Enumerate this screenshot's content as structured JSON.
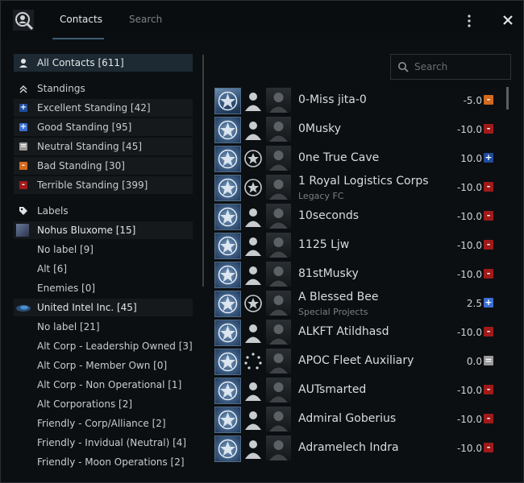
{
  "tabs": {
    "contacts": "Contacts",
    "search": "Search"
  },
  "colors": {
    "excellent": "#1e4c9c",
    "good": "#3a6fd0",
    "neutral": "#9a9a9a",
    "bad": "#d26a1e",
    "terrible": "#a11a1a"
  },
  "left": {
    "all_contacts": "All Contacts [611]",
    "standings_header": "Standings",
    "standings": [
      "Excellent Standing [42]",
      "Good Standing [95]",
      "Neutral Standing [45]",
      "Bad Standing [30]",
      "Terrible Standing [399]"
    ],
    "labels_header": "Labels",
    "group1": {
      "name": "Nohus Bluxome [15]",
      "items": [
        "No label [9]",
        "Alt [6]",
        "Enemies [0]"
      ]
    },
    "group2": {
      "name": "United Intel Inc. [45]",
      "items": [
        "No label [21]",
        "Alt Corp - Leadership Owned [3]",
        "Alt Corp - Member Own [0]",
        "Alt Corp - Non Operational [1]",
        "Alt Corporations [2]",
        "Friendly - Corp/Alliance [2]",
        "Friendly - Invidual (Neutral) [4]",
        "Friendly - Moon Operations [2]"
      ]
    }
  },
  "search": {
    "placeholder": "Search"
  },
  "contacts": [
    {
      "name": "0-Miss jita-0",
      "sub": "",
      "value": "-5.0",
      "std": "bad"
    },
    {
      "name": "0Musky",
      "sub": "",
      "value": "-10.0",
      "std": "terrible"
    },
    {
      "name": "0ne True Cave",
      "sub": "",
      "value": "10.0",
      "std": "excellent"
    },
    {
      "name": "1 Royal Logistics Corps",
      "sub": "Legacy FC",
      "value": "-10.0",
      "std": "terrible"
    },
    {
      "name": "10seconds",
      "sub": "",
      "value": "-10.0",
      "std": "terrible"
    },
    {
      "name": "1125 Ljw",
      "sub": "",
      "value": "-10.0",
      "std": "terrible"
    },
    {
      "name": "81stMusky",
      "sub": "",
      "value": "-10.0",
      "std": "terrible"
    },
    {
      "name": "A Blessed Bee",
      "sub": "Special Projects",
      "value": "2.5",
      "std": "good"
    },
    {
      "name": "ALKFT Atildhasd",
      "sub": "",
      "value": "-10.0",
      "std": "terrible"
    },
    {
      "name": "APOC Fleet Auxiliary",
      "sub": "",
      "value": "0.0",
      "std": "neutral"
    },
    {
      "name": "AUTsmarted",
      "sub": "",
      "value": "-10.0",
      "std": "terrible"
    },
    {
      "name": "Admiral Goberius",
      "sub": "",
      "value": "-10.0",
      "std": "terrible"
    },
    {
      "name": "Adramelech Indra",
      "sub": "",
      "value": "-10.0",
      "std": "terrible"
    }
  ]
}
